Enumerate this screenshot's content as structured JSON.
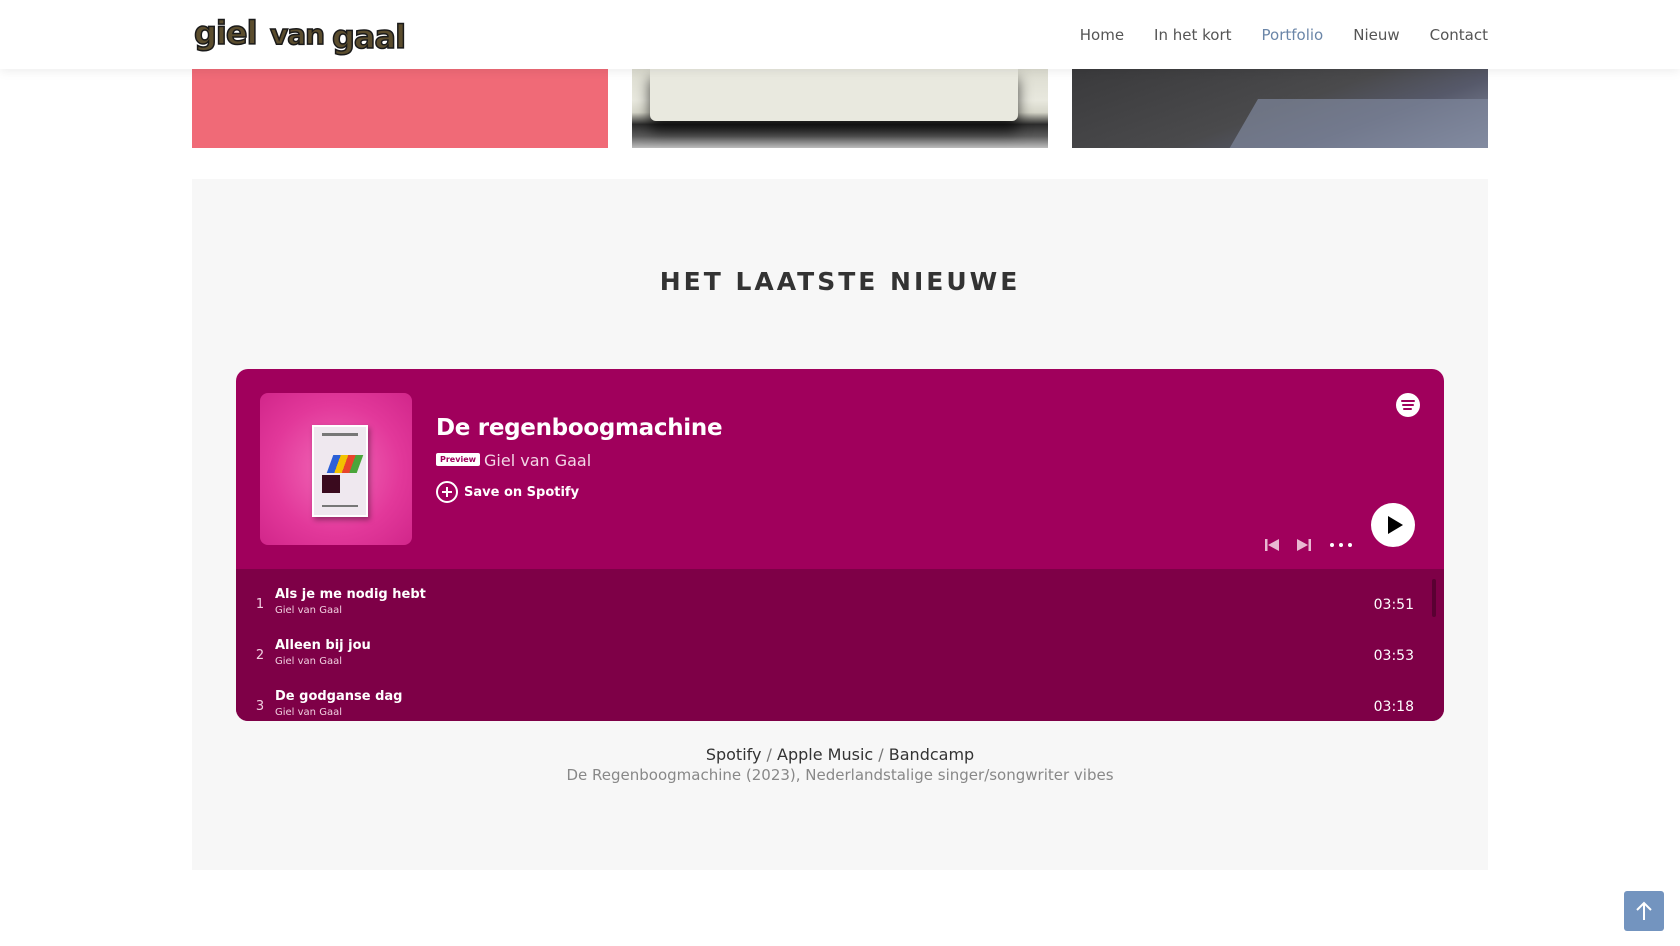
{
  "header": {
    "logo_text": "giel van gaal",
    "nav": [
      {
        "label": "Home",
        "active": false
      },
      {
        "label": "In het kort",
        "active": false
      },
      {
        "label": "Portfolio",
        "active": true
      },
      {
        "label": "Nieuw",
        "active": false
      },
      {
        "label": "Contact",
        "active": false
      }
    ]
  },
  "section": {
    "title": "HET LAATSTE NIEUWE",
    "player": {
      "album_title": "De regenboogmachine",
      "preview_label": "Preview",
      "artist": "Giel van Gaal",
      "save_label": "Save on Spotify",
      "tracks": [
        {
          "num": "1",
          "name": "Als je me nodig hebt",
          "artist": "Giel van Gaal",
          "duration": "03:51"
        },
        {
          "num": "2",
          "name": "Alleen bij jou",
          "artist": "Giel van Gaal",
          "duration": "03:53"
        },
        {
          "num": "3",
          "name": "De godganse dag",
          "artist": "Giel van Gaal",
          "duration": "03:18"
        }
      ],
      "colors": {
        "background": "#a0005c",
        "tracklist": "#7e0047"
      }
    },
    "links": {
      "spotify": "Spotify",
      "apple_music": "Apple Music",
      "bandcamp": "Bandcamp",
      "separator": "/"
    },
    "caption": "De Regenboogmachine (2023), Nederlandstalige singer/songwriter vibes"
  },
  "icons": {
    "spotify": "spotify-logo-icon",
    "add": "plus-circle-icon",
    "prev": "skip-back-icon",
    "next": "skip-forward-icon",
    "more": "more-dots-icon",
    "play": "play-icon",
    "to_top": "arrow-up-icon"
  }
}
